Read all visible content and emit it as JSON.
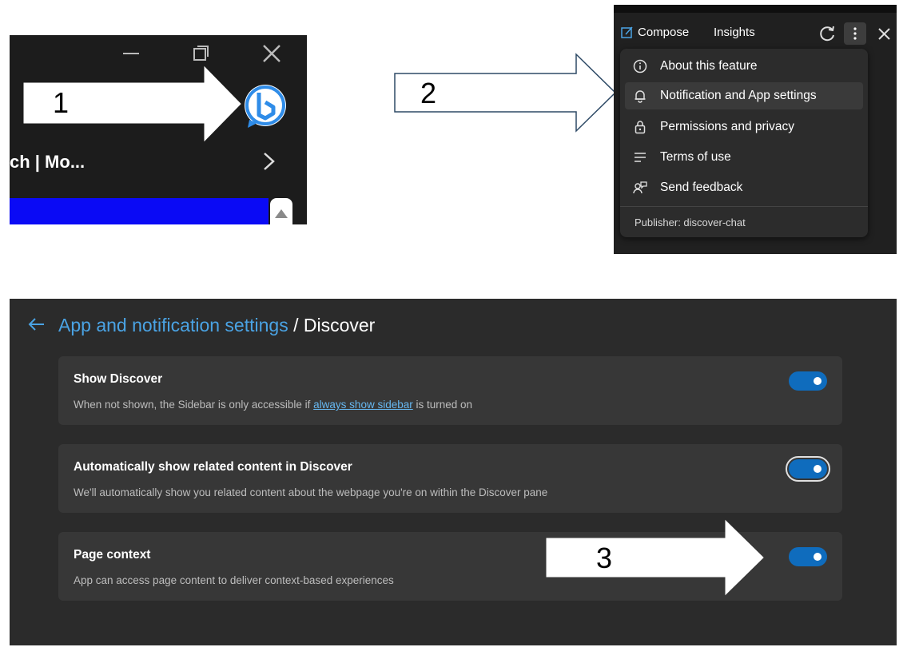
{
  "steps": {
    "one": "1",
    "two": "2",
    "three": "3"
  },
  "panel1": {
    "tab_text": "ch | Mo...",
    "icons": [
      "minimize-icon",
      "restore-icon",
      "close-icon",
      "bing-discover-icon",
      "chevron-right-icon",
      "scroll-up-icon"
    ],
    "colors": {
      "background": "#1c1c1c",
      "tab_strip": "#0a0af5",
      "bing_blue": "#2f8ce8"
    }
  },
  "panel2": {
    "tabs": {
      "compose": "Compose",
      "insights": "Insights"
    },
    "icons": [
      "compose-icon",
      "refresh-icon",
      "more-options-icon",
      "close-icon"
    ],
    "menu": [
      {
        "label": "About this feature",
        "icon": "info-icon"
      },
      {
        "label": "Notification and App settings",
        "icon": "bell-icon",
        "highlighted": true
      },
      {
        "label": "Permissions and privacy",
        "icon": "lock-icon"
      },
      {
        "label": "Terms of use",
        "icon": "lines-icon"
      },
      {
        "label": "Send feedback",
        "icon": "feedback-icon"
      }
    ],
    "publisher": "Publisher: discover-chat"
  },
  "panel3": {
    "breadcrumb": {
      "link": "App and notification settings",
      "separator": " / ",
      "current": "Discover"
    },
    "settings": [
      {
        "title": "Show Discover",
        "desc_before": "When not shown, the Sidebar is only accessible if ",
        "desc_link": "always show sidebar",
        "desc_after": " is turned on",
        "enabled": true
      },
      {
        "title": "Automatically show related content in Discover",
        "desc": "We'll automatically show you related content about the webpage you're on within the Discover pane",
        "enabled": true
      },
      {
        "title": "Page context",
        "desc": "App can access page content to deliver context-based experiences",
        "enabled": true
      }
    ],
    "colors": {
      "background": "#2b2b2b",
      "card": "#373737",
      "toggle_on": "#0f6cbd",
      "link": "#4aa3e4"
    }
  }
}
